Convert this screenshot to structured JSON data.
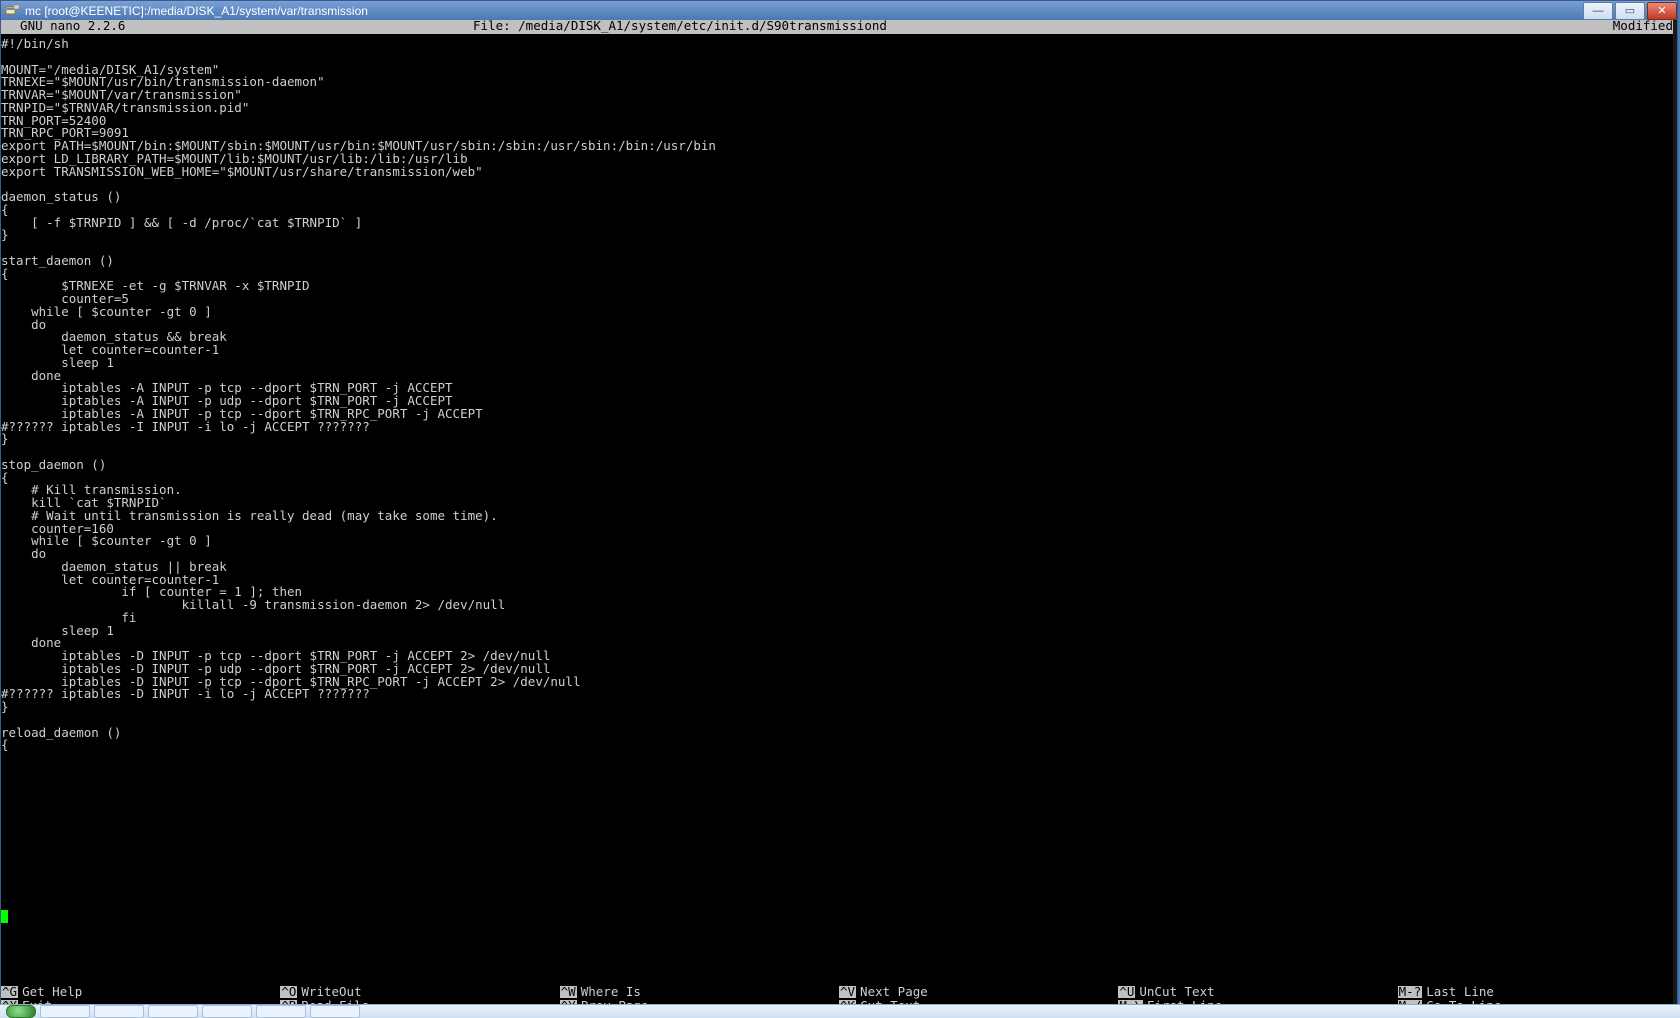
{
  "window": {
    "title": "mc [root@KEENETIC]:/media/DISK_A1/system/var/transmission"
  },
  "nano": {
    "app_label": "  GNU nano 2.2.6",
    "file_label": "File: /media/DISK_A1/system/etc/init.d/S90transmissiond",
    "modified_label": "Modified"
  },
  "editor": {
    "content": "#!/bin/sh\n\nMOUNT=\"/media/DISK_A1/system\"\nTRNEXE=\"$MOUNT/usr/bin/transmission-daemon\"\nTRNVAR=\"$MOUNT/var/transmission\"\nTRNPID=\"$TRNVAR/transmission.pid\"\nTRN_PORT=52400\nTRN_RPC_PORT=9091\nexport PATH=$MOUNT/bin:$MOUNT/sbin:$MOUNT/usr/bin:$MOUNT/usr/sbin:/sbin:/usr/sbin:/bin:/usr/bin\nexport LD_LIBRARY_PATH=$MOUNT/lib:$MOUNT/usr/lib:/lib:/usr/lib\nexport TRANSMISSION_WEB_HOME=\"$MOUNT/usr/share/transmission/web\"\n\ndaemon_status ()\n{\n    [ -f $TRNPID ] && [ -d /proc/`cat $TRNPID` ]\n}\n\nstart_daemon ()\n{\n        $TRNEXE -et -g $TRNVAR -x $TRNPID\n        counter=5\n    while [ $counter -gt 0 ]\n    do\n        daemon_status && break\n        let counter=counter-1\n        sleep 1\n    done\n        iptables -A INPUT -p tcp --dport $TRN_PORT -j ACCEPT\n        iptables -A INPUT -p udp --dport $TRN_PORT -j ACCEPT\n        iptables -A INPUT -p tcp --dport $TRN_RPC_PORT -j ACCEPT\n#?????? iptables -I INPUT -i lo -j ACCEPT ???????\n}\n\nstop_daemon ()\n{\n    # Kill transmission.\n    kill `cat $TRNPID`\n    # Wait until transmission is really dead (may take some time).\n    counter=160\n    while [ $counter -gt 0 ]\n    do\n        daemon_status || break\n        let counter=counter-1\n                if [ counter = 1 ]; then\n                        killall -9 transmission-daemon 2> /dev/null\n                fi\n        sleep 1\n    done\n        iptables -D INPUT -p tcp --dport $TRN_PORT -j ACCEPT 2> /dev/null\n        iptables -D INPUT -p udp --dport $TRN_PORT -j ACCEPT 2> /dev/null\n        iptables -D INPUT -p tcp --dport $TRN_RPC_PORT -j ACCEPT 2> /dev/null\n#?????? iptables -D INPUT -i lo -j ACCEPT ???????\n}\n\nreload_daemon ()\n{"
  },
  "shortcuts": {
    "row1": [
      {
        "key": "^G",
        "label": "Get Help"
      },
      {
        "key": "^O",
        "label": "WriteOut"
      },
      {
        "key": "^W",
        "label": "Where Is"
      },
      {
        "key": "^V",
        "label": "Next Page"
      },
      {
        "key": "^U",
        "label": "UnCut Text"
      },
      {
        "key": "M-?",
        "label": "Last Line"
      }
    ],
    "row2": [
      {
        "key": "^X",
        "label": "Exit"
      },
      {
        "key": "^R",
        "label": "Read File"
      },
      {
        "key": "^Y",
        "label": "Prev Page"
      },
      {
        "key": "^K",
        "label": "Cut Text"
      },
      {
        "key": "M-\\",
        "label": "First Line"
      },
      {
        "key": "M-/",
        "label": "Go To Line"
      }
    ]
  }
}
